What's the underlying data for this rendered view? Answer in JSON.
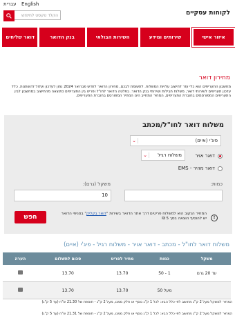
{
  "header": {
    "lang_he": "עברית",
    "lang_en": "English",
    "search_placeholder": "הקלד טקסט לחיפוש",
    "brand_title": "לקוחות עסקיים"
  },
  "nav": {
    "items": [
      "איזור אישי",
      "שירותים ומידע",
      "השירות הבולאי",
      "בנק הדואר",
      "דואר שליחים"
    ]
  },
  "page": {
    "title": "מחירון דואר",
    "description": "מחשבון התעריפים הוא כלי עזר לחישוב עלויות המשלוח. לתשומת לבכם, מחירון הדואר לחדש פברואר 2024 נתון לעדכון ועלול להשתנות. כלל עדכון תעריפים לשירותי דואר, משלוח חבילות ושירותי בנק הדואר. בפלטה הדואר לחו\"ל ופריט בין התעריפים כתוצאה מהחישוב במחשבון לבין התעריפים המפורסמים בחוברת התעריפים, המחיר המחייב הינו המחיר המפורסם בחוברת התעריפים."
  },
  "calculator": {
    "title": "משלוח דואר לחו\"ל/מכתב",
    "destination": "פיג'י (איים)",
    "options": [
      {
        "label": "דואר אויר",
        "selected": true,
        "sub_select": "משלוח רגיל"
      },
      {
        "label": "דואר מהיר - EMS",
        "selected": false
      }
    ],
    "quantity_label": "כמות:",
    "quantity_value": "",
    "weight_label": "משקל (גרם):",
    "weight_value": "10",
    "note_prefix": "המחיר הנקוב הוא למשלוח פריטים דרך אתר הדואר בשירות \"",
    "note_link": "דואר בקליק",
    "note_suffix": "\" בסניפי הדואר יש להוסיף הוצאה בסך 5 ₪",
    "calculate_label": "חפש"
  },
  "results": {
    "title": "משלוח דואר לחו\"ל - מכתב - דואר אויר - משלוח רגיל - פיג'י (איים)",
    "headers": [
      "משקל",
      "כמות",
      "מחיר לפריט",
      "סכום לתשלום",
      "הערה"
    ],
    "rows": [
      {
        "weight": "עד 20 גרם",
        "quantity": "1 - 50",
        "unit_price": "13.70",
        "total": "13.70"
      },
      {
        "weight": "",
        "quantity": "מעל 50",
        "unit_price": "13.70",
        "total": "13.70"
      }
    ],
    "footnotes": [
      "המחיר למשקל מעל 2 ק\"ג מחושב לפי כלל הבא: לכל 1 ק\"ג נוסף או חלק ממנו, מעל 2 ק\"ג - תוספת של 21.30 ש\"ח (עד 5 ק\"ג)",
      "המחיר למשקל מעל 2 ק\"ג מחושב לפי כלל הבא: לכל 1 ק\"ג נוסף או חלק ממנו, מעל 2 ק\"ג - תוספת של 21.31 ש\"ח (עד 5 ק\"ג)"
    ]
  },
  "colors": {
    "brand_red": "#d6001c",
    "table_header": "#6d8c9c",
    "result_title": "#5b8fb5"
  }
}
